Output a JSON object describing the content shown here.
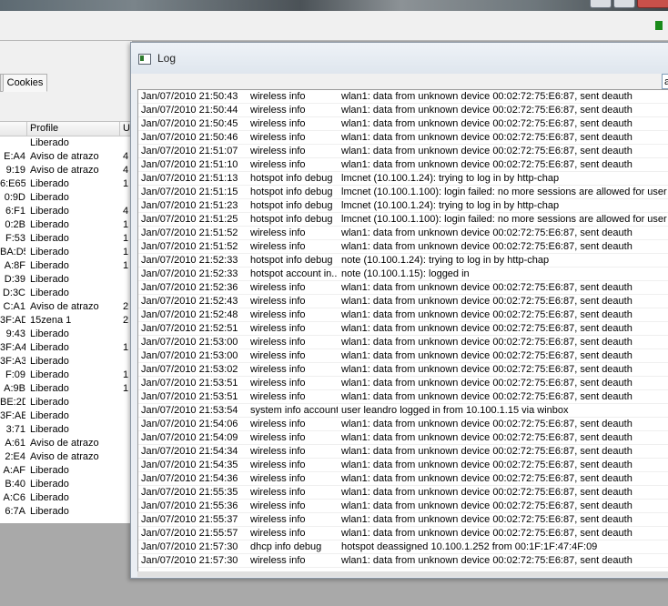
{
  "log_window": {
    "title": "Log",
    "filter_value": "a",
    "entries": [
      {
        "time": "Jan/07/2010 21:50:43",
        "topics": "wireless info",
        "message": "wlan1: data from unknown device 00:02:72:75:E6:87, sent deauth"
      },
      {
        "time": "Jan/07/2010 21:50:44",
        "topics": "wireless info",
        "message": "wlan1: data from unknown device 00:02:72:75:E6:87, sent deauth"
      },
      {
        "time": "Jan/07/2010 21:50:45",
        "topics": "wireless info",
        "message": "wlan1: data from unknown device 00:02:72:75:E6:87, sent deauth"
      },
      {
        "time": "Jan/07/2010 21:50:46",
        "topics": "wireless info",
        "message": "wlan1: data from unknown device 00:02:72:75:E6:87, sent deauth"
      },
      {
        "time": "Jan/07/2010 21:51:07",
        "topics": "wireless info",
        "message": "wlan1: data from unknown device 00:02:72:75:E6:87, sent deauth"
      },
      {
        "time": "Jan/07/2010 21:51:10",
        "topics": "wireless info",
        "message": "wlan1: data from unknown device 00:02:72:75:E6:87, sent deauth"
      },
      {
        "time": "Jan/07/2010 21:51:13",
        "topics": "hotspot info debug",
        "message": "lmcnet (10.100.1.24): trying to log in by http-chap"
      },
      {
        "time": "Jan/07/2010 21:51:15",
        "topics": "hotspot info debug",
        "message": "lmcnet (10.100.1.100): login failed: no more sessions are allowed for user"
      },
      {
        "time": "Jan/07/2010 21:51:23",
        "topics": "hotspot info debug",
        "message": "lmcnet (10.100.1.24): trying to log in by http-chap"
      },
      {
        "time": "Jan/07/2010 21:51:25",
        "topics": "hotspot info debug",
        "message": "lmcnet (10.100.1.100): login failed: no more sessions are allowed for user"
      },
      {
        "time": "Jan/07/2010 21:51:52",
        "topics": "wireless info",
        "message": "wlan1: data from unknown device 00:02:72:75:E6:87, sent deauth"
      },
      {
        "time": "Jan/07/2010 21:51:52",
        "topics": "wireless info",
        "message": "wlan1: data from unknown device 00:02:72:75:E6:87, sent deauth"
      },
      {
        "time": "Jan/07/2010 21:52:33",
        "topics": "hotspot info debug",
        "message": "note (10.100.1.24): trying to log in by http-chap"
      },
      {
        "time": "Jan/07/2010 21:52:33",
        "topics": "hotspot account in...",
        "message": "note (10.100.1.15): logged in"
      },
      {
        "time": "Jan/07/2010 21:52:36",
        "topics": "wireless info",
        "message": "wlan1: data from unknown device 00:02:72:75:E6:87, sent deauth"
      },
      {
        "time": "Jan/07/2010 21:52:43",
        "topics": "wireless info",
        "message": "wlan1: data from unknown device 00:02:72:75:E6:87, sent deauth"
      },
      {
        "time": "Jan/07/2010 21:52:48",
        "topics": "wireless info",
        "message": "wlan1: data from unknown device 00:02:72:75:E6:87, sent deauth"
      },
      {
        "time": "Jan/07/2010 21:52:51",
        "topics": "wireless info",
        "message": "wlan1: data from unknown device 00:02:72:75:E6:87, sent deauth"
      },
      {
        "time": "Jan/07/2010 21:53:00",
        "topics": "wireless info",
        "message": "wlan1: data from unknown device 00:02:72:75:E6:87, sent deauth"
      },
      {
        "time": "Jan/07/2010 21:53:00",
        "topics": "wireless info",
        "message": "wlan1: data from unknown device 00:02:72:75:E6:87, sent deauth"
      },
      {
        "time": "Jan/07/2010 21:53:02",
        "topics": "wireless info",
        "message": "wlan1: data from unknown device 00:02:72:75:E6:87, sent deauth"
      },
      {
        "time": "Jan/07/2010 21:53:51",
        "topics": "wireless info",
        "message": "wlan1: data from unknown device 00:02:72:75:E6:87, sent deauth"
      },
      {
        "time": "Jan/07/2010 21:53:51",
        "topics": "wireless info",
        "message": "wlan1: data from unknown device 00:02:72:75:E6:87, sent deauth"
      },
      {
        "time": "Jan/07/2010 21:53:54",
        "topics": "system info account",
        "message": "user leandro logged in from 10.100.1.15 via winbox"
      },
      {
        "time": "Jan/07/2010 21:54:06",
        "topics": "wireless info",
        "message": "wlan1: data from unknown device 00:02:72:75:E6:87, sent deauth"
      },
      {
        "time": "Jan/07/2010 21:54:09",
        "topics": "wireless info",
        "message": "wlan1: data from unknown device 00:02:72:75:E6:87, sent deauth"
      },
      {
        "time": "Jan/07/2010 21:54:34",
        "topics": "wireless info",
        "message": "wlan1: data from unknown device 00:02:72:75:E6:87, sent deauth"
      },
      {
        "time": "Jan/07/2010 21:54:35",
        "topics": "wireless info",
        "message": "wlan1: data from unknown device 00:02:72:75:E6:87, sent deauth"
      },
      {
        "time": "Jan/07/2010 21:54:36",
        "topics": "wireless info",
        "message": "wlan1: data from unknown device 00:02:72:75:E6:87, sent deauth"
      },
      {
        "time": "Jan/07/2010 21:55:35",
        "topics": "wireless info",
        "message": "wlan1: data from unknown device 00:02:72:75:E6:87, sent deauth"
      },
      {
        "time": "Jan/07/2010 21:55:36",
        "topics": "wireless info",
        "message": "wlan1: data from unknown device 00:02:72:75:E6:87, sent deauth"
      },
      {
        "time": "Jan/07/2010 21:55:37",
        "topics": "wireless info",
        "message": "wlan1: data from unknown device 00:02:72:75:E6:87, sent deauth"
      },
      {
        "time": "Jan/07/2010 21:55:57",
        "topics": "wireless info",
        "message": "wlan1: data from unknown device 00:02:72:75:E6:87, sent deauth"
      },
      {
        "time": "Jan/07/2010 21:57:30",
        "topics": "dhcp info debug",
        "message": "hotspot deassigned 10.100.1.252 from 00:1F:1F:47:4F:09"
      },
      {
        "time": "Jan/07/2010 21:57:30",
        "topics": "wireless info",
        "message": "wlan1: data from unknown device 00:02:72:75:E6:87, sent deauth"
      }
    ]
  },
  "background_window": {
    "tab_label": "Cookies",
    "columns": [
      "Profile",
      "U"
    ],
    "rows": [
      {
        "mac": "",
        "profile": "Liberado",
        "extra": ""
      },
      {
        "mac": "E:A4",
        "profile": "Aviso de atrazo",
        "extra": "4"
      },
      {
        "mac": "9:19",
        "profile": "Aviso de atrazo",
        "extra": "4"
      },
      {
        "mac": "6:E65",
        "profile": "Liberado",
        "extra": "1"
      },
      {
        "mac": "0:9D",
        "profile": "Liberado",
        "extra": ""
      },
      {
        "mac": "6:F1",
        "profile": "Liberado",
        "extra": "4"
      },
      {
        "mac": "0:2B",
        "profile": "Liberado",
        "extra": "1"
      },
      {
        "mac": "F:53",
        "profile": "Liberado",
        "extra": "1"
      },
      {
        "mac": "BA:D5",
        "profile": "Liberado",
        "extra": "1"
      },
      {
        "mac": "A:8F",
        "profile": "Liberado",
        "extra": "1"
      },
      {
        "mac": "D:39",
        "profile": "Liberado",
        "extra": ""
      },
      {
        "mac": "D:3C",
        "profile": "Liberado",
        "extra": ""
      },
      {
        "mac": "C:A1",
        "profile": "Aviso de atrazo",
        "extra": "2"
      },
      {
        "mac": "3F:AD",
        "profile": "15zena 1",
        "extra": "2"
      },
      {
        "mac": "9:43",
        "profile": "Liberado",
        "extra": ""
      },
      {
        "mac": "3F:A4",
        "profile": "Liberado",
        "extra": "1"
      },
      {
        "mac": "3F:A3",
        "profile": "Liberado",
        "extra": ""
      },
      {
        "mac": "F:09",
        "profile": "Liberado",
        "extra": "1"
      },
      {
        "mac": "A:9B",
        "profile": "Liberado",
        "extra": "1"
      },
      {
        "mac": "BE:2D",
        "profile": "Liberado",
        "extra": ""
      },
      {
        "mac": "3F:AE",
        "profile": "Liberado",
        "extra": ""
      },
      {
        "mac": "3:71",
        "profile": "Liberado",
        "extra": ""
      },
      {
        "mac": "A:61",
        "profile": "Aviso de atrazo",
        "extra": ""
      },
      {
        "mac": "2:E4",
        "profile": "Aviso de atrazo",
        "extra": ""
      },
      {
        "mac": "A:AF",
        "profile": "Liberado",
        "extra": ""
      },
      {
        "mac": "B:40",
        "profile": "Liberado",
        "extra": ""
      },
      {
        "mac": "A:C6",
        "profile": "Liberado",
        "extra": ""
      },
      {
        "mac": "6:7A",
        "profile": "Liberado",
        "extra": ""
      }
    ]
  },
  "icons": {
    "log_window_icon": "window-icon",
    "status": "status-indicator-icon"
  },
  "colors": {
    "status_indicator": "#1a8a1a",
    "desktop_bg": "#a9a9a9"
  }
}
